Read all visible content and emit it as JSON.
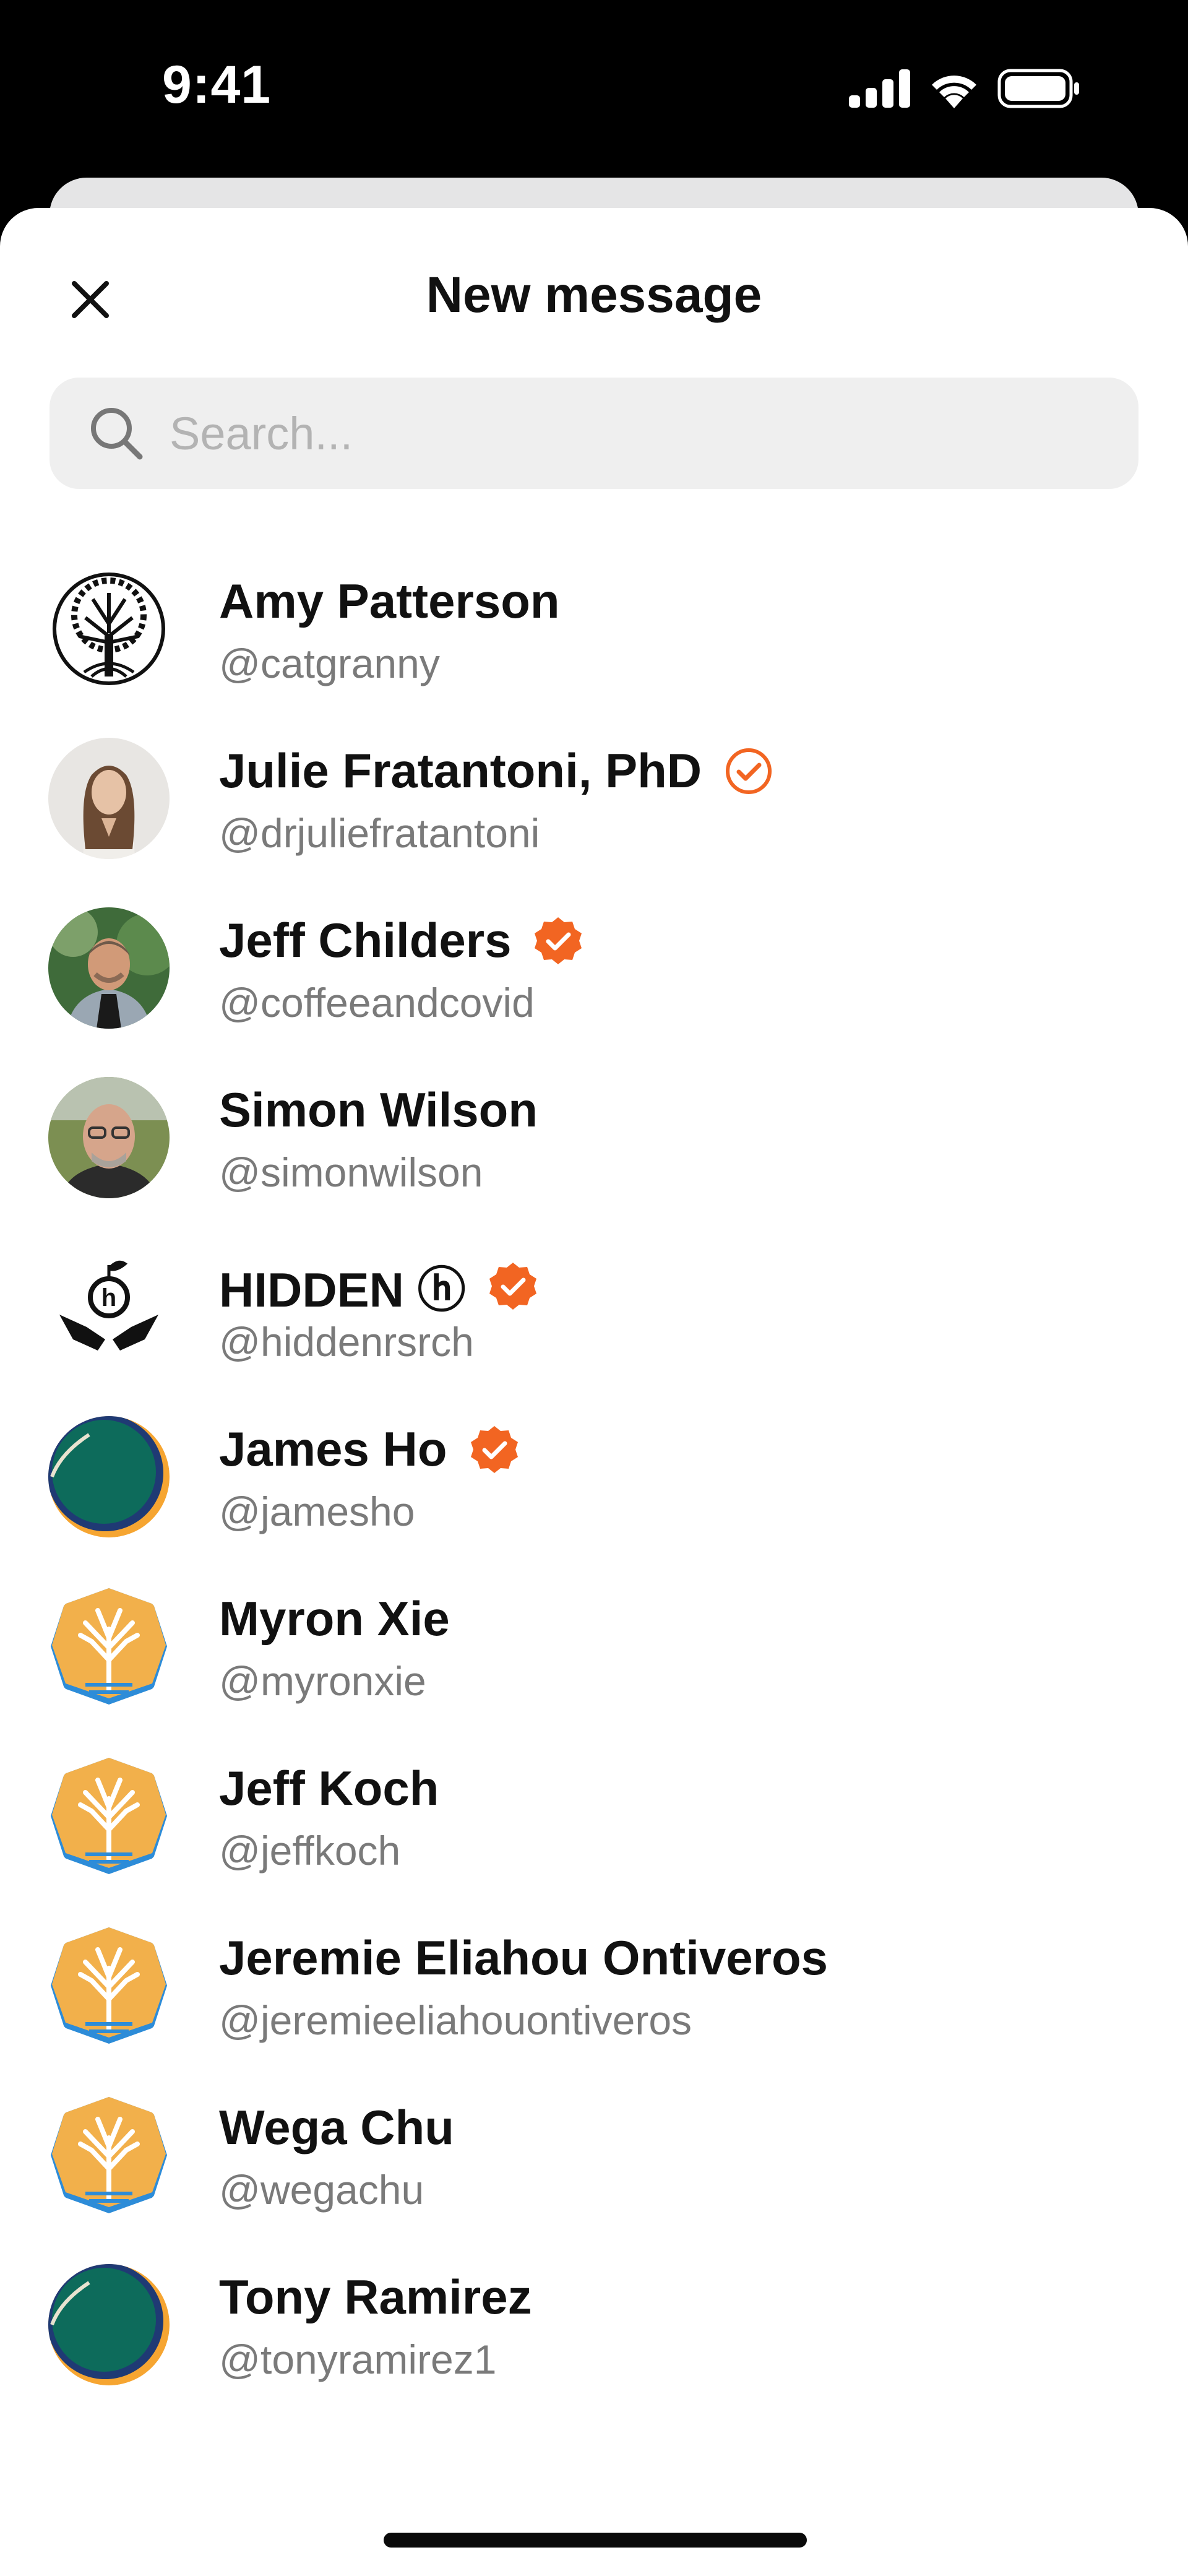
{
  "status_bar": {
    "time": "9:41"
  },
  "header": {
    "title": "New message"
  },
  "search": {
    "placeholder": "Search..."
  },
  "colors": {
    "accent": "#f26522",
    "avatar_teal": "#0d6b5b",
    "avatar_gold": "#f2b04b"
  },
  "contacts": [
    {
      "name": "Amy Patterson",
      "handle": "@catgranny",
      "verified": "none",
      "avatar": "tree-of-life-icon"
    },
    {
      "name": "Julie Fratantoni, PhD",
      "handle": "@drjuliefratantoni",
      "verified": "outline",
      "avatar": "photo"
    },
    {
      "name": "Jeff Childers",
      "handle": "@coffeeandcovid",
      "verified": "filled",
      "avatar": "photo"
    },
    {
      "name": "Simon Wilson",
      "handle": "@simonwilson",
      "verified": "none",
      "avatar": "photo"
    },
    {
      "name": "HIDDEN ⓗ",
      "handle": "@hiddenrsrch",
      "verified": "filled",
      "avatar": "hands-logo-icon"
    },
    {
      "name": "James Ho",
      "handle": "@jamesho",
      "verified": "filled",
      "avatar": "teal-circle"
    },
    {
      "name": "Myron Xie",
      "handle": "@myronxie",
      "verified": "none",
      "avatar": "tree-badge"
    },
    {
      "name": "Jeff Koch",
      "handle": "@jeffkoch",
      "verified": "none",
      "avatar": "tree-badge"
    },
    {
      "name": "Jeremie Eliahou Ontiveros",
      "handle": "@jeremieeliahouontiveros",
      "verified": "none",
      "avatar": "tree-badge"
    },
    {
      "name": "Wega Chu",
      "handle": "@wegachu",
      "verified": "none",
      "avatar": "tree-badge"
    },
    {
      "name": "Tony Ramirez",
      "handle": "@tonyramirez1",
      "verified": "none",
      "avatar": "teal-circle"
    }
  ]
}
